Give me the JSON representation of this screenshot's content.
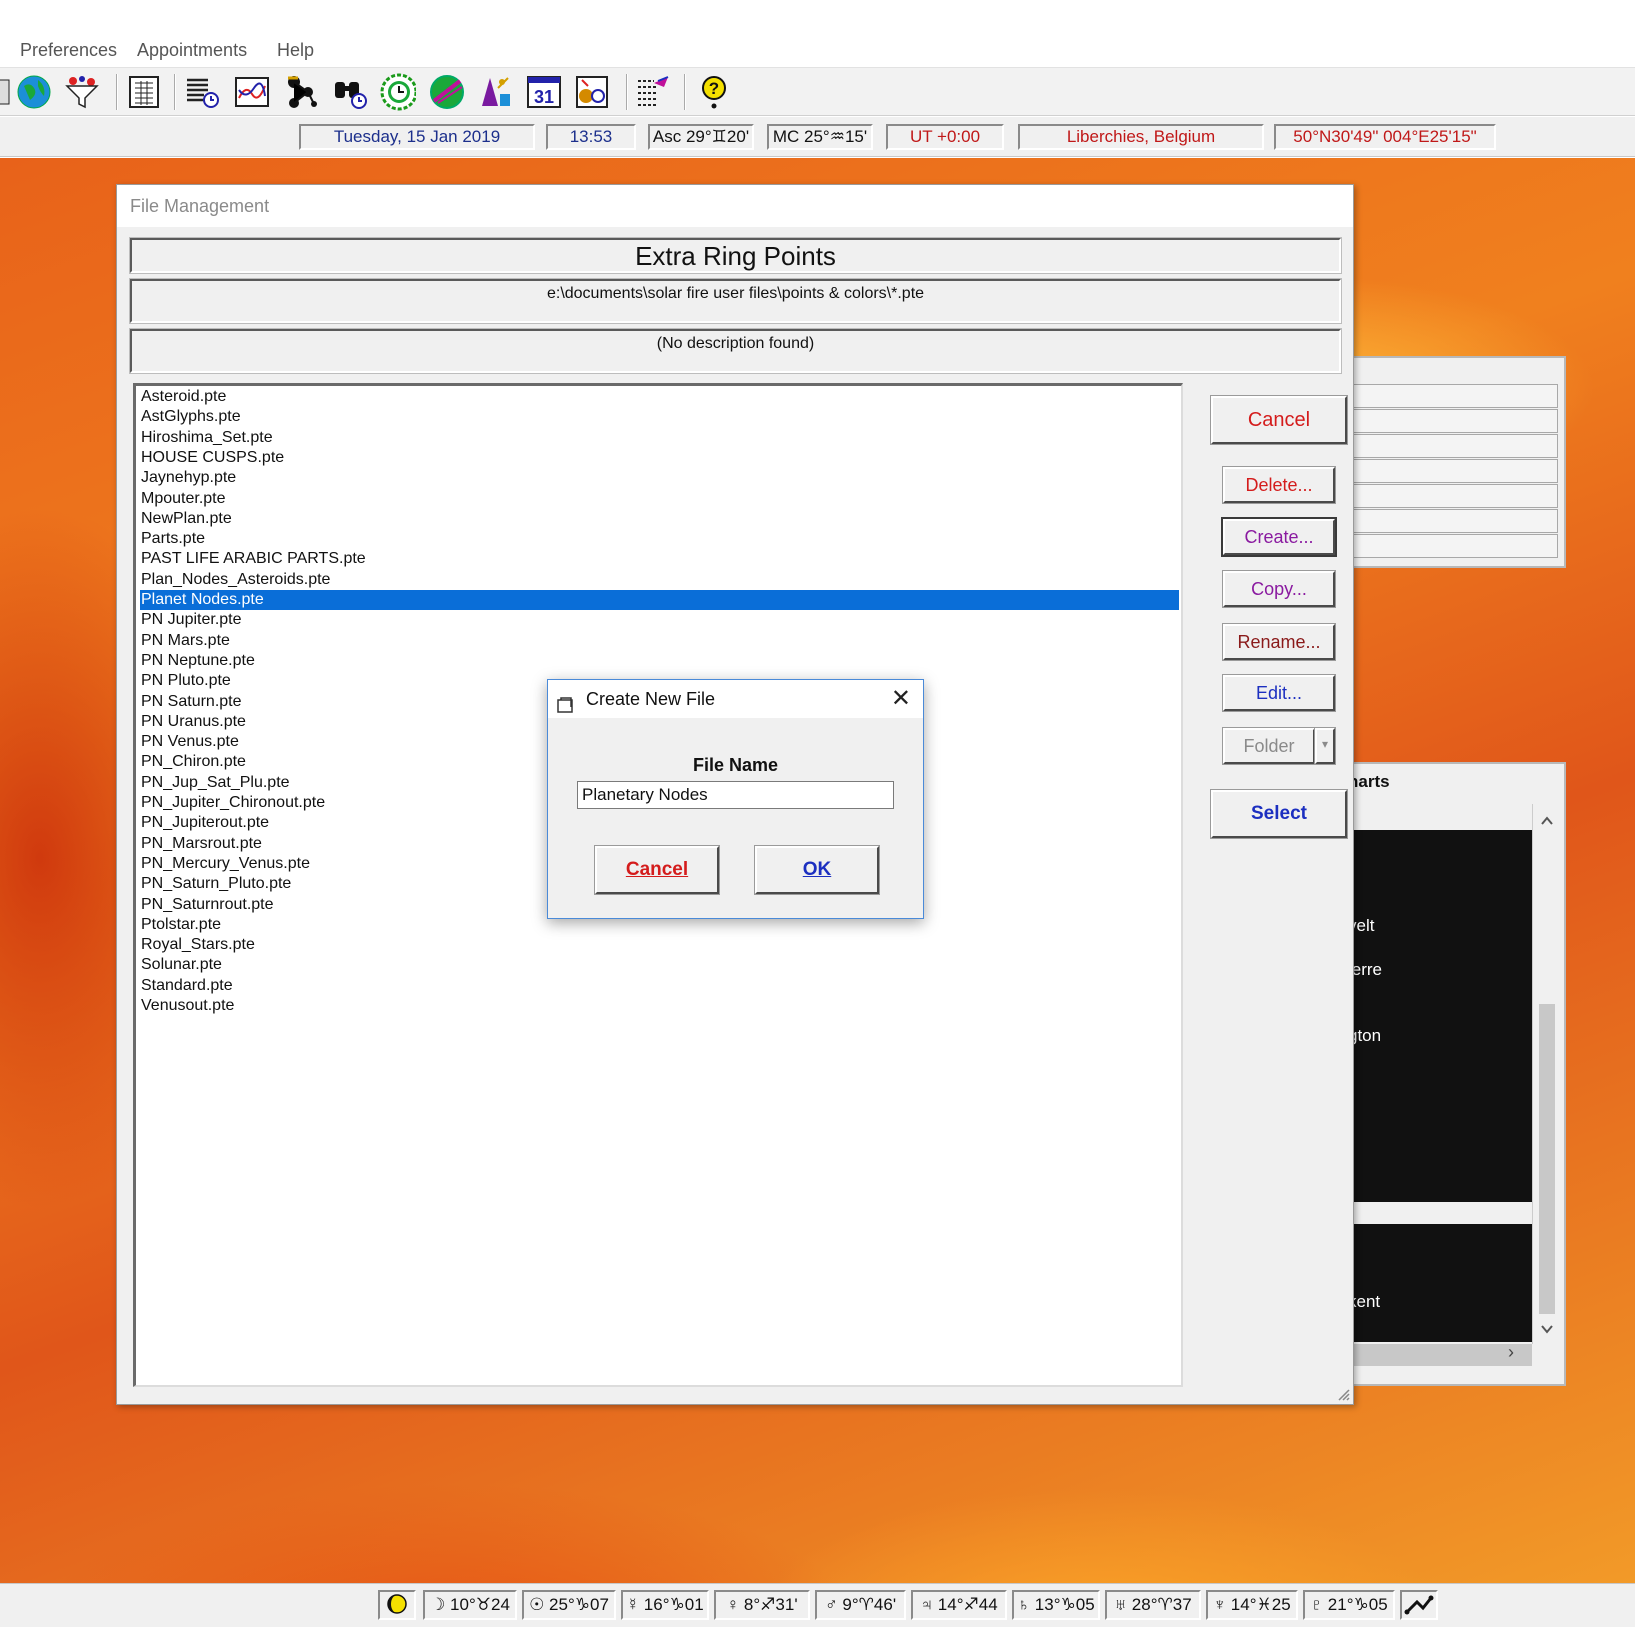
{
  "menu": {
    "items": [
      "Preferences",
      "Appointments",
      "Help"
    ]
  },
  "toolbar": {
    "icons": [
      "calc-icon",
      "globe-icon",
      "filter-icon",
      "spreadsheet-icon",
      "listing-icon",
      "graph-icon",
      "pattern-icon",
      "binoculars-icon",
      "clock-icon",
      "transit-icon",
      "wizard-icon",
      "calendar-icon",
      "print-icon",
      "report-icon",
      "help-icon"
    ],
    "calendar_label": "31",
    "help_glyph": "?"
  },
  "infobar": {
    "date": "Tuesday, 15 Jan 2019",
    "time": "13:53",
    "asc": "Asc 29°♊20'",
    "mc": "MC 25°♒15'",
    "ut": "UT +0:00",
    "location": "Liberchies, Belgium",
    "coords": "50°N30'49\"  004°E25'15\""
  },
  "file_management": {
    "title": "File Management",
    "heading": "Extra Ring Points",
    "path": "e:\\documents\\solar fire user files\\points & colors\\*.pte",
    "description": "(No description found)",
    "files": [
      "Asteroid.pte",
      "AstGlyphs.pte",
      "Hiroshima_Set.pte",
      "HOUSE CUSPS.pte",
      "Jaynehyp.pte",
      "Mpouter.pte",
      "NewPlan.pte",
      "Parts.pte",
      "PAST LIFE ARABIC PARTS.pte",
      "Plan_Nodes_Asteroids.pte",
      "Planet Nodes.pte",
      "PN Jupiter.pte",
      "PN Mars.pte",
      "PN Neptune.pte",
      "PN Pluto.pte",
      "PN Saturn.pte",
      "PN Uranus.pte",
      "PN Venus.pte",
      "PN_Chiron.pte",
      "PN_Jup_Sat_Plu.pte",
      "PN_Jupiter_Chironout.pte",
      "PN_Jupiterout.pte",
      "PN_Marsrout.pte",
      "PN_Mercury_Venus.pte",
      "PN_Saturn_Pluto.pte",
      "PN_Saturnrout.pte",
      "Ptolstar.pte",
      "Royal_Stars.pte",
      "Solunar.pte",
      "Standard.pte",
      "Venusout.pte"
    ],
    "selected_file": "Planet Nodes.pte",
    "buttons": {
      "cancel": "Cancel",
      "delete": "Delete...",
      "create": "Create...",
      "copy": "Copy...",
      "rename": "Rename...",
      "edit": "Edit...",
      "folder": "Folder",
      "select": "Select"
    }
  },
  "create_dialog": {
    "title": "Create New File",
    "label": "File Name",
    "value": "Planetary Nodes",
    "cancel": "Cancel",
    "ok": "OK"
  },
  "background_panel": {
    "charts_label": "harts",
    "fragments": [
      "velt",
      "ierre",
      "gton",
      "kent"
    ]
  },
  "statusbar": {
    "fields": [
      "",
      "☽ 10°♉24",
      "☉ 25°♑07",
      "☿ 16°♑01",
      "♀ 8°♐31'",
      "♂ 9°♈46'",
      "♃ 14°♐44",
      "♄ 13°♑05",
      "♅ 28°♈37",
      "♆ 14°♓25",
      "♇ 21°♑05",
      ""
    ]
  },
  "colors": {
    "selection": "#0a6ed8",
    "cancel_red": "#d41c1c",
    "link_blue": "#1c2fc0"
  }
}
